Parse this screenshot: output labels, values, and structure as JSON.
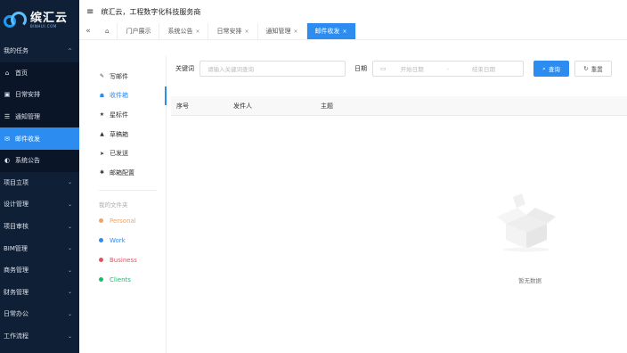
{
  "app": {
    "logo_title": "缤汇云",
    "logo_sub": "BINHUI.COM",
    "header_title": "缤汇云，工程数字化科技服务商"
  },
  "sidebar": {
    "items": [
      {
        "label": "我的任务",
        "chevron": "^",
        "icon": ""
      },
      {
        "label": "首页",
        "chevron": "",
        "icon": "⌂"
      },
      {
        "label": "日常安排",
        "chevron": "",
        "icon": "▣"
      },
      {
        "label": "通知管理",
        "chevron": "",
        "icon": "☰"
      },
      {
        "label": "邮件收发",
        "chevron": "",
        "icon": "✉"
      },
      {
        "label": "系统公告",
        "chevron": "",
        "icon": "◐"
      },
      {
        "label": "项目立项",
        "chevron": "⌄",
        "icon": ""
      },
      {
        "label": "设计管理",
        "chevron": "⌄",
        "icon": ""
      },
      {
        "label": "项目审核",
        "chevron": "⌄",
        "icon": ""
      },
      {
        "label": "BIM管理",
        "chevron": "⌄",
        "icon": ""
      },
      {
        "label": "商务管理",
        "chevron": "⌄",
        "icon": ""
      },
      {
        "label": "财务管理",
        "chevron": "⌄",
        "icon": ""
      },
      {
        "label": "日常办公",
        "chevron": "⌄",
        "icon": ""
      },
      {
        "label": "工作流程",
        "chevron": "⌄",
        "icon": ""
      }
    ]
  },
  "tabs": {
    "collapse": "«",
    "home_icon": "⌂",
    "items": [
      {
        "label": "门户展示",
        "closable": ""
      },
      {
        "label": "系统公告",
        "closable": "×"
      },
      {
        "label": "日常安排",
        "closable": "×"
      },
      {
        "label": "通知管理",
        "closable": "×"
      },
      {
        "label": "邮件收发",
        "closable": "×"
      }
    ]
  },
  "mail": {
    "items": [
      {
        "label": "写邮件",
        "icon": "✎"
      },
      {
        "label": "收件箱",
        "icon": "☗"
      },
      {
        "label": "星标件",
        "icon": "★"
      },
      {
        "label": "草稿箱",
        "icon": "▲"
      },
      {
        "label": "已发送",
        "icon": "➤"
      },
      {
        "label": "邮箱配置",
        "icon": "✱"
      }
    ],
    "folder_title": "我的文件夹",
    "folders": [
      {
        "label": "Personal",
        "color": "#f5a25d"
      },
      {
        "label": "Work",
        "color": "#2d8cf0"
      },
      {
        "label": "Business",
        "color": "#ed4e5a"
      },
      {
        "label": "Clients",
        "color": "#19be6b"
      }
    ]
  },
  "filter": {
    "keyword_label": "关键词",
    "keyword_placeholder": "请输入关键词查询",
    "date_label": "日期",
    "date_start": "开始日期",
    "date_sep": "-",
    "date_end": "结束日期",
    "search_btn": "查询",
    "reset_btn": "重置"
  },
  "table": {
    "columns": [
      "序号",
      "发件人",
      "主题"
    ],
    "empty_text": "暂无数据"
  }
}
